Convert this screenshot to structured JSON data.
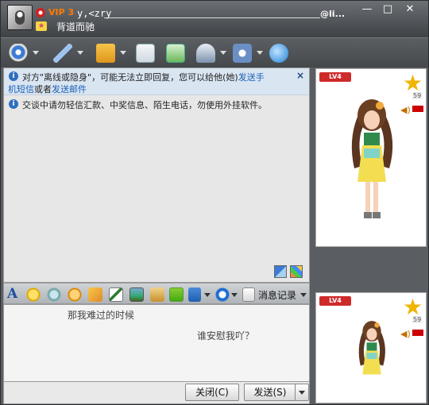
{
  "title": {
    "vip": "VIP 3",
    "nickname": "y,<zry",
    "email": "@li...",
    "signature": "背道而驰"
  },
  "window_buttons": {
    "minimize": "—",
    "maximize": "□",
    "close": "✕"
  },
  "toolbar": {
    "items": [
      {
        "name": "video"
      },
      {
        "name": "voice"
      },
      {
        "name": "file-transfer"
      },
      {
        "name": "sms"
      },
      {
        "name": "create-group"
      },
      {
        "name": "remote-assistance"
      },
      {
        "name": "apps"
      },
      {
        "name": "share"
      }
    ]
  },
  "chat": {
    "notice1_pre": "对方\"离线或隐身\"，可能无法立即回复，您可以给他(她)",
    "notice1_link1": "发送手",
    "notice1_link1b": "机短信",
    "notice1_mid": "或者",
    "notice1_link2": "发送邮件",
    "notice1_close": "×",
    "notice2": "交谈中请勿轻信汇款、中奖信息、陌生电话，勿使用外挂软件。"
  },
  "formatbar": {
    "font_label": "A",
    "history_label": "消息记录"
  },
  "input": {
    "line1": "那我难过的时候",
    "line2": "谁安慰我吖？"
  },
  "buttons": {
    "close": "关闭(C)",
    "send": "发送(S)"
  },
  "show": {
    "level": "LV4",
    "star_count": "59"
  },
  "colors": {
    "accent": "#1c5fb8",
    "vip": "#ff7a00",
    "notice_bg": "#d9e5f1"
  }
}
